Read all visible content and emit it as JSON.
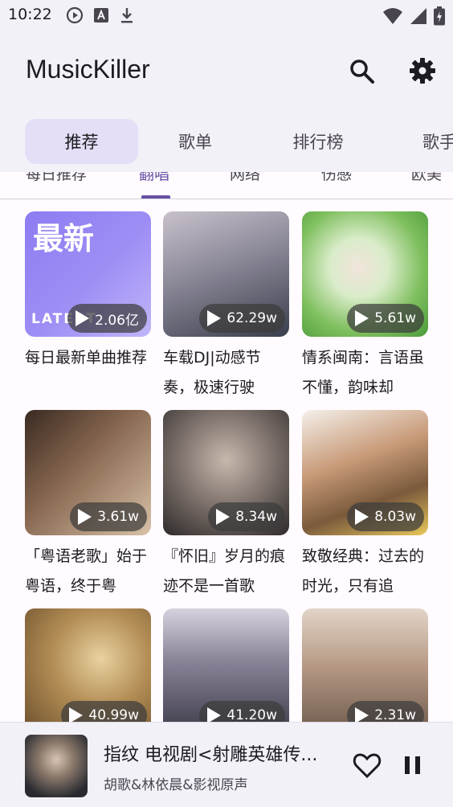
{
  "status": {
    "time": "10:22",
    "left_icons": [
      "play-circle-icon",
      "font-icon",
      "download-icon"
    ],
    "right_icons": [
      "wifi-icon",
      "signal-icon",
      "battery-icon"
    ]
  },
  "app_bar": {
    "title": "MusicKiller",
    "search_icon": "search-icon",
    "settings_icon": "gear-icon"
  },
  "top_tabs": [
    {
      "label": "推荐",
      "active": true
    },
    {
      "label": "歌单",
      "active": false
    },
    {
      "label": "排行榜",
      "active": false
    },
    {
      "label": "歌手",
      "active": false
    }
  ],
  "sub_tabs": [
    {
      "label": "每日推荐",
      "active": false
    },
    {
      "label": "翻唱",
      "active": true
    },
    {
      "label": "网络",
      "active": false
    },
    {
      "label": "伤感",
      "active": false
    },
    {
      "label": "欧美",
      "active": false
    }
  ],
  "playlists": [
    {
      "title": "每日最新单曲推荐",
      "plays": "2.06亿",
      "cover_text": "最新",
      "cover_sub": "LATEST",
      "colors": [
        "#7b6cf0",
        "#b7a9f7"
      ]
    },
    {
      "title": "车载DJ|动感节奏，极速行驶",
      "plays": "62.29w",
      "colors": [
        "#3a3f4d",
        "#c9c2cc"
      ]
    },
    {
      "title": "情系闽南：言语虽不懂，韵味却",
      "plays": "5.61w",
      "colors": [
        "#5aa64a",
        "#d9ecc9"
      ]
    },
    {
      "title": "「粤语老歌」始于粤语，终于粤",
      "plays": "3.61w",
      "colors": [
        "#6a4a36",
        "#d8c2a8"
      ]
    },
    {
      "title": "『怀旧』岁月的痕迹不是一首歌",
      "plays": "8.34w",
      "colors": [
        "#2e2a2a",
        "#9a918c"
      ]
    },
    {
      "title": "致敬经典：过去的时光，只有追",
      "plays": "8.03w",
      "colors": [
        "#7a5a3c",
        "#e8c85a"
      ]
    },
    {
      "title": "",
      "plays": "40.99w",
      "colors": [
        "#6b4f2c",
        "#d9b77a"
      ]
    },
    {
      "title": "",
      "plays": "41.20w",
      "colors": [
        "#3d3b4a",
        "#b9b3c4"
      ]
    },
    {
      "title": "",
      "plays": "2.31w",
      "colors": [
        "#9c7e6a",
        "#e2d4c8"
      ]
    }
  ],
  "player": {
    "title": "指纹 电视剧<射雕英雄传...",
    "artist": "胡歌&林依晨&影视原声",
    "like_icon": "heart-outline-icon",
    "pause_icon": "pause-icon"
  }
}
